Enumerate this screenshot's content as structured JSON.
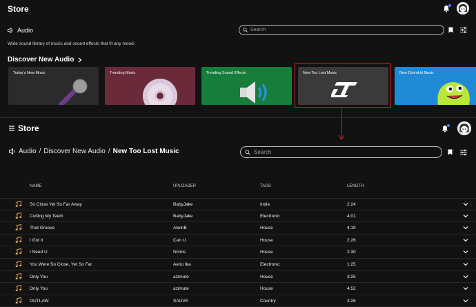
{
  "store": {
    "title": "Store"
  },
  "audio_page": {
    "section_label": "Audio",
    "search_placeholder": "Search",
    "description": "Wide sound library of music and sound effects that fit any mood.",
    "discover_heading": "Discover New Audio",
    "cards": [
      {
        "label": "Today's New Music",
        "bg": "#2a2a2a"
      },
      {
        "label": "Trending Music",
        "bg": "#6b2a3a"
      },
      {
        "label": "Trending Sound Effects",
        "bg": "#177d3a"
      },
      {
        "label": "New Too Lost Music",
        "bg": "#3a3a3a",
        "selected": true
      },
      {
        "label": "New Distrokid Music",
        "bg": "#1e8ad6"
      }
    ]
  },
  "detail_page": {
    "breadcrumb": [
      "Audio",
      "Discover New Audio",
      "New Too Lost Music"
    ],
    "search_placeholder": "Search",
    "columns": [
      "NAME",
      "UPLOADER",
      "TAGS",
      "LENGTH"
    ],
    "rows": [
      {
        "name": "So Close Yet So Far Away",
        "uploader": "BabyJake",
        "tags": "Indie",
        "length": "2:24"
      },
      {
        "name": "Cutting My Teeth",
        "uploader": "BabyJake",
        "tags": "Electronic",
        "length": "4:01"
      },
      {
        "name": "That Groove",
        "uploader": "AlwinB",
        "tags": "House",
        "length": "4:19"
      },
      {
        "name": "I Got It",
        "uploader": "Can U",
        "tags": "House",
        "length": "2:26"
      },
      {
        "name": "I Need U",
        "uploader": "Ncmis",
        "tags": "House",
        "length": "2:30"
      },
      {
        "name": "You Were So Close, Yet So Far",
        "uploader": "Aeriu Ika",
        "tags": "Electronic",
        "length": "1:25"
      },
      {
        "name": "Only You",
        "uploader": "azimute",
        "tags": "House",
        "length": "3:25"
      },
      {
        "name": "Only You",
        "uploader": "azimute",
        "tags": "House",
        "length": "4:52"
      },
      {
        "name": "OUTLAW",
        "uploader": "SAUVE",
        "tags": "Country",
        "length": "3:28"
      }
    ]
  },
  "colors": {
    "highlight": "#d42020",
    "notification_dot": "#3b82f6",
    "background": "#121212"
  }
}
